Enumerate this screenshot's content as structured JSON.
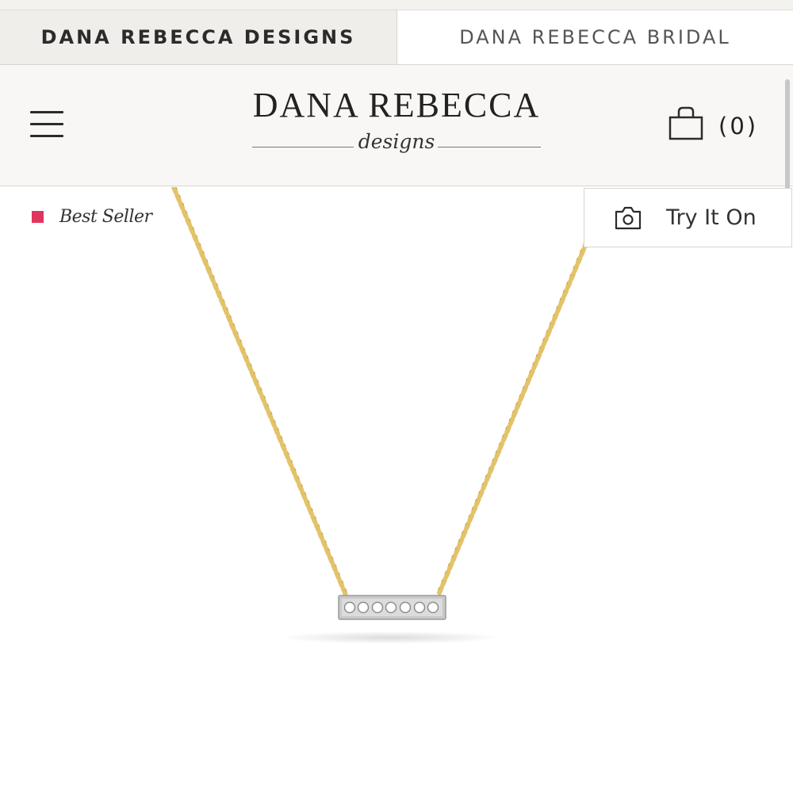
{
  "brand_tabs": [
    {
      "label": "DANA REBECCA DESIGNS",
      "active": true
    },
    {
      "label": "DANA REBECCA BRIDAL",
      "active": false
    }
  ],
  "header": {
    "menu_icon": "hamburger-menu-icon",
    "logo": {
      "title": "DANA REBECCA",
      "subtitle": "designs"
    },
    "cart": {
      "icon": "shopping-bag-icon",
      "count_label": "(0)"
    }
  },
  "product": {
    "badge": {
      "label": "Best Seller",
      "color": "#e0355d"
    },
    "try_on": {
      "label": "Try It On",
      "icon": "camera-icon"
    },
    "image": {
      "chain_color": "#e2c36a",
      "bar_color": "#c9c9c9"
    }
  }
}
